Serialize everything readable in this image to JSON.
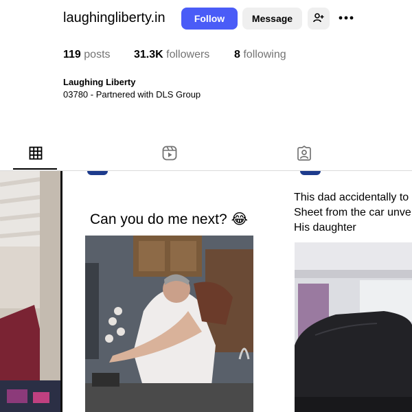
{
  "profile": {
    "username": "laughingliberty.in",
    "full_name": "Laughing Liberty",
    "bio": "03780 - Partnered with DLS Group"
  },
  "actions": {
    "follow_label": "Follow",
    "message_label": "Message"
  },
  "stats": {
    "posts_count": "119",
    "posts_label": "posts",
    "followers_count": "31.3K",
    "followers_label": "followers",
    "following_count": "8",
    "following_label": "following"
  },
  "tabs": [
    {
      "icon": "grid-icon",
      "active": true
    },
    {
      "icon": "reels-icon",
      "active": false
    },
    {
      "icon": "tagged-icon",
      "active": false
    }
  ],
  "posts": [
    {
      "caption": ""
    },
    {
      "caption": "Can you do me next? 😂"
    },
    {
      "caption_lines": [
        "This dad accidentally to",
        "Sheet from the car unve",
        "His daughter"
      ]
    }
  ],
  "colors": {
    "accent": "#4a5cf7",
    "button_secondary": "#efefef",
    "muted_text": "#737373",
    "divider": "#dbdbdb"
  }
}
